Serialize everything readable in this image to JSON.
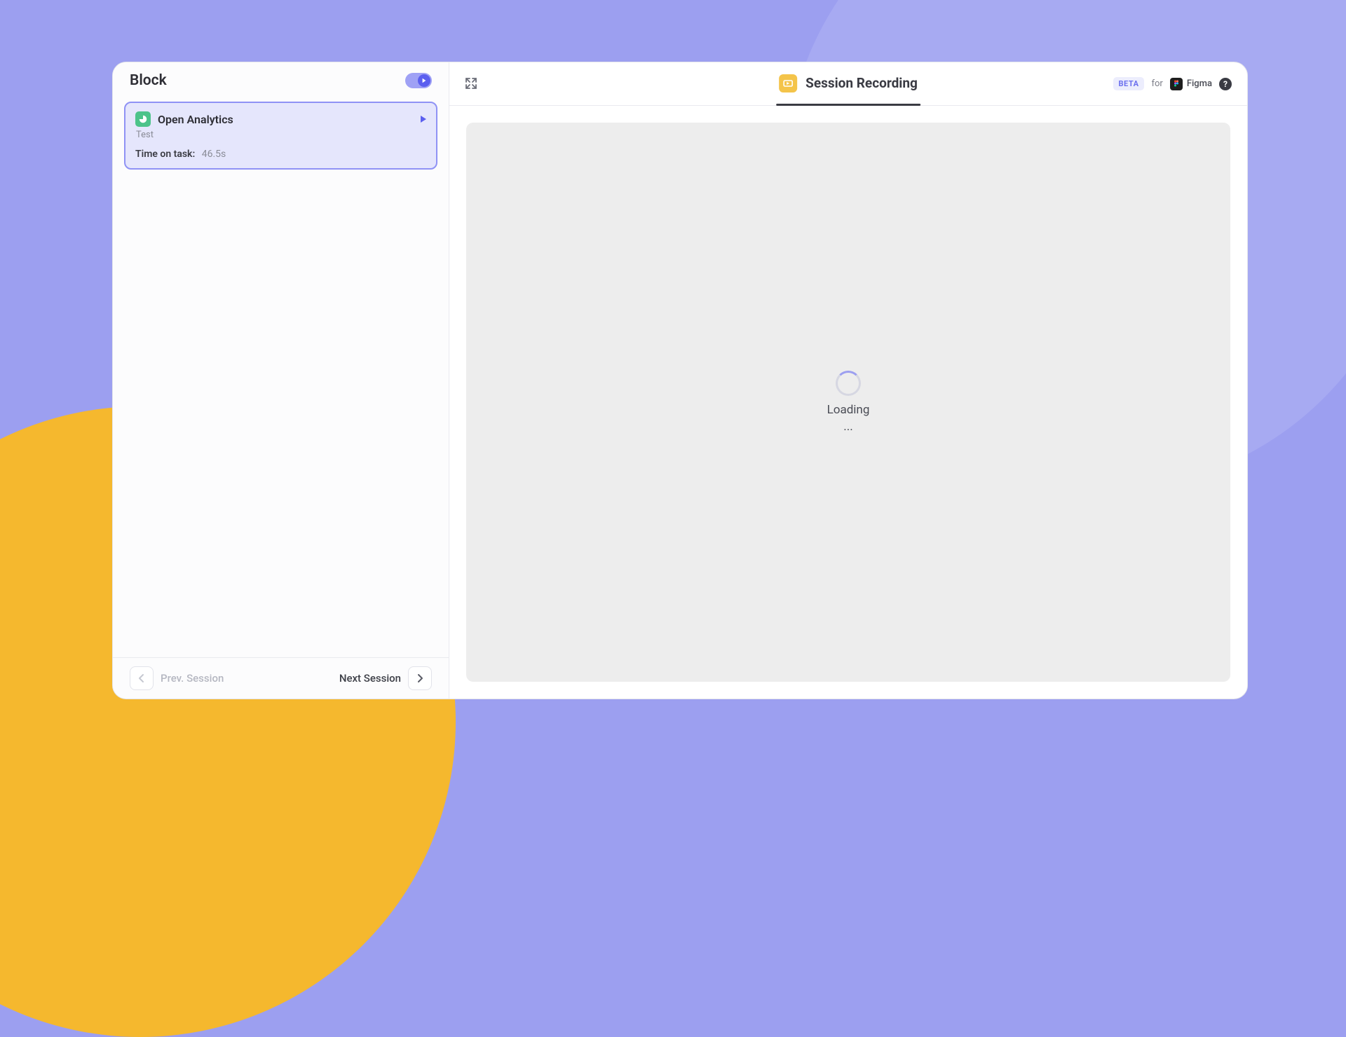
{
  "sidebar": {
    "title": "Block",
    "toggle_on": true,
    "task": {
      "title": "Open Analytics",
      "subtitle": "Test",
      "meta_label": "Time on task:",
      "meta_value": "46.5s"
    },
    "nav": {
      "prev_label": "Prev. Session",
      "next_label": "Next Session",
      "prev_enabled": false,
      "next_enabled": true
    }
  },
  "header": {
    "tab_label": "Session Recording",
    "beta": "BETA",
    "for": "for",
    "platform": "Figma"
  },
  "recording": {
    "state": "Loading",
    "dots": "..."
  },
  "colors": {
    "accent": "#5B5FEF",
    "bg": "#9C9FF0",
    "yellow": "#F5B82E"
  }
}
